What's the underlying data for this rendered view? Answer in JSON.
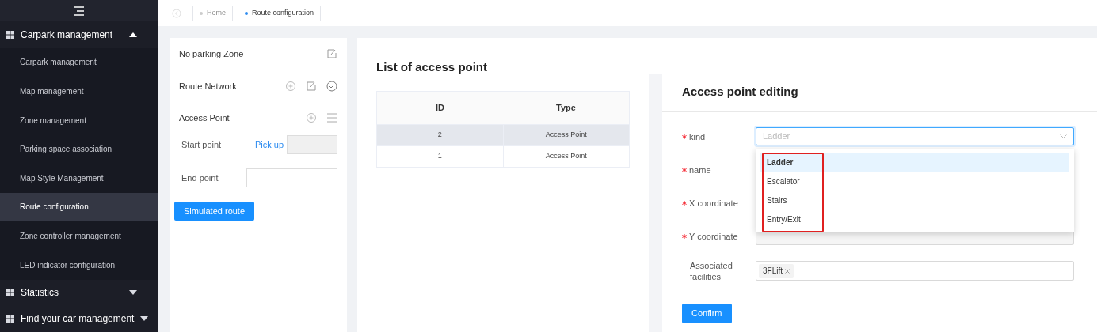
{
  "sidebar": {
    "groups": [
      {
        "label": "Carpark management",
        "expanded": true,
        "children": [
          {
            "label": "Carpark management",
            "selected": false
          },
          {
            "label": "Map management",
            "selected": false
          },
          {
            "label": "Zone management",
            "selected": false
          },
          {
            "label": "Parking space association",
            "selected": false
          },
          {
            "label": "Map Style Management",
            "selected": false
          },
          {
            "label": "Route configuration",
            "selected": true
          },
          {
            "label": "Zone controller management",
            "selected": false
          },
          {
            "label": "LED indicator configuration",
            "selected": false
          }
        ]
      },
      {
        "label": "Statistics",
        "expanded": false
      },
      {
        "label": "Find your car management",
        "expanded": false
      }
    ]
  },
  "tabs": [
    {
      "label": "Home",
      "selected": false
    },
    {
      "label": "Route configuration",
      "selected": true
    }
  ],
  "tools": {
    "sections": [
      {
        "label": "No parking Zone"
      },
      {
        "label": "Route Network"
      },
      {
        "label": "Access Point"
      }
    ],
    "start_point": {
      "label": "Start point",
      "link": "Pick up"
    },
    "end_point": {
      "label": "End point"
    },
    "button": "Simulated route"
  },
  "table": {
    "title": "List of access point",
    "columns": [
      "ID",
      "Type"
    ],
    "rows": [
      {
        "cells": [
          "2",
          "Access Point"
        ],
        "selected": true
      },
      {
        "cells": [
          "1",
          "Access Point"
        ],
        "selected": false
      }
    ]
  },
  "form": {
    "title": "Access point editing",
    "fields": [
      {
        "label": "kind",
        "required": true,
        "kind": "select",
        "placeholder": "Ladder"
      },
      {
        "label": "name",
        "required": true,
        "kind": "covered"
      },
      {
        "label": "X coordinate",
        "required": true,
        "kind": "covered"
      },
      {
        "label": "Y coordinate",
        "required": true,
        "kind": "input"
      },
      {
        "label": "Associated facilities",
        "required": false,
        "kind": "tags",
        "tags": [
          "3FLift"
        ]
      }
    ],
    "dropdown": {
      "options": [
        {
          "label": "Ladder",
          "selected": true
        },
        {
          "label": "Escalator",
          "selected": false
        },
        {
          "label": "Stairs",
          "selected": false
        },
        {
          "label": "Entry/Exit",
          "selected": false
        }
      ]
    },
    "confirm": "Confirm"
  }
}
